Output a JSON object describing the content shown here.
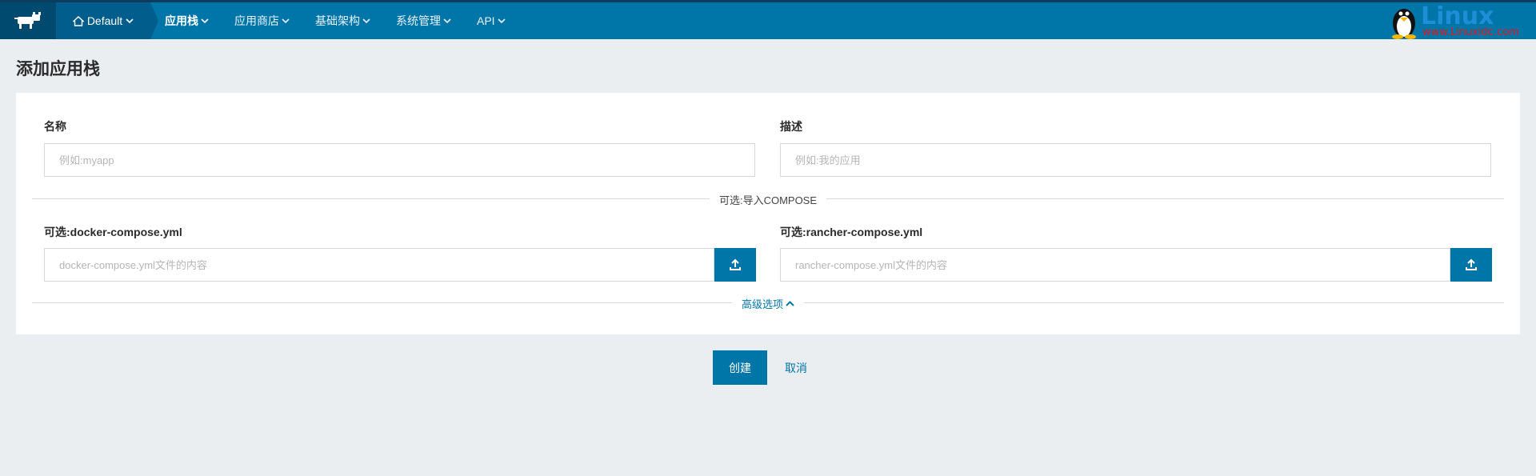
{
  "navbar": {
    "environment": "Default",
    "items": [
      {
        "label": "应用栈",
        "active": true
      },
      {
        "label": "应用商店",
        "active": false
      },
      {
        "label": "基础架构",
        "active": false
      },
      {
        "label": "系统管理",
        "active": false
      },
      {
        "label": "API",
        "active": false
      }
    ],
    "watermark": "Linux",
    "watermark_sub": "www.Linuxidc.com"
  },
  "page": {
    "title": "添加应用栈"
  },
  "form": {
    "name_label": "名称",
    "name_placeholder": "例如:myapp",
    "desc_label": "描述",
    "desc_placeholder": "例如:我的应用",
    "import_divider": "可选:导入COMPOSE",
    "docker_label": "可选:docker-compose.yml",
    "docker_placeholder": "docker-compose.yml文件的内容",
    "rancher_label": "可选:rancher-compose.yml",
    "rancher_placeholder": "rancher-compose.yml文件的内容",
    "advanced_label": "高级选项"
  },
  "actions": {
    "create": "创建",
    "cancel": "取消"
  },
  "colors": {
    "primary": "#0075a8",
    "navbar": "#0075a8",
    "background": "#ebeef0"
  }
}
